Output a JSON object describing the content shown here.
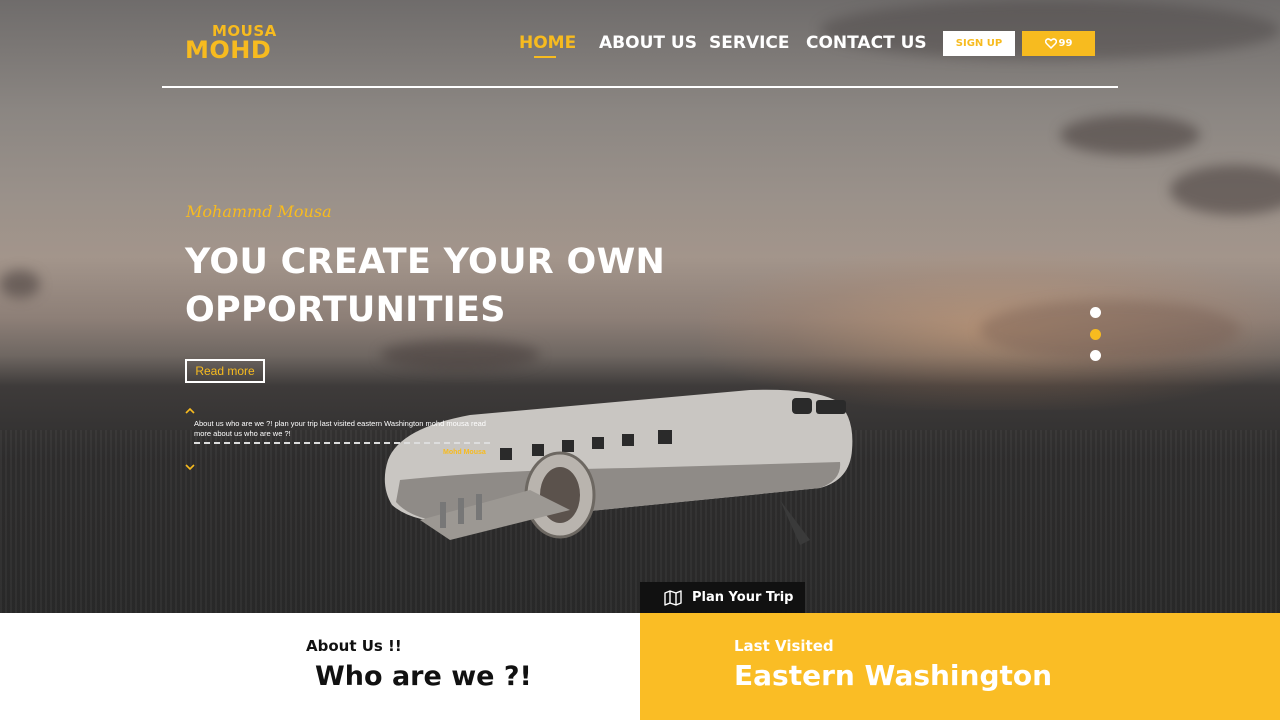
{
  "logo": {
    "top": "MOUSA",
    "bottom": "MOHD"
  },
  "nav": {
    "items": [
      {
        "label": "HOME",
        "active": true
      },
      {
        "label": "ABOUT US",
        "active": false
      },
      {
        "label": "SERVICE",
        "active": false
      },
      {
        "label": "CONTACT US",
        "active": false
      }
    ],
    "signup_label": "SIGN UP",
    "favorites_count": "99"
  },
  "hero": {
    "script_name": "Mohammd Mousa",
    "headline_line1": "YOU CREATE YOUR OWN",
    "headline_line2": "OPPORTUNITIES",
    "read_more": "Read more",
    "excerpt": "About us who are we ?! plan your trip last visited eastern Washington mohd mousa read more about us who are we ?!",
    "excerpt_author": "Mohd Mousa",
    "slider_dots": 3,
    "active_slide": 2
  },
  "plan_trip": {
    "label": "Plan Your Trip",
    "icon": "map-icon"
  },
  "about": {
    "small": "About Us !!",
    "big": "Who are we ?!"
  },
  "last_visited": {
    "small": "Last Visited",
    "big": "Eastern Washington"
  },
  "colors": {
    "accent": "#f7bb1f",
    "bottom_panel": "#fabd25",
    "plan_bg": "#111111"
  }
}
